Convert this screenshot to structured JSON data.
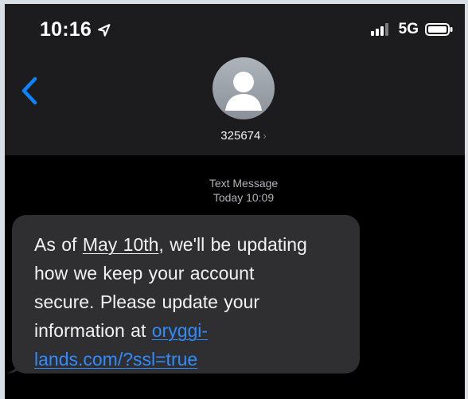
{
  "status_bar": {
    "time": "10:16",
    "network": "5G"
  },
  "header": {
    "back_icon": "chevron-left-icon",
    "avatar_icon": "person-icon",
    "contact_name": "325674",
    "contact_chevron": "›"
  },
  "conversation": {
    "message_type": "Text Message",
    "timestamp": "Today 10:09",
    "message": {
      "line1_prefix": "As of",
      "line1_highlight": "May 10th",
      "line1_suffix": ", we'll be updating",
      "line2": "how we keep your account",
      "line3": "secure. Please update your",
      "line4_prefix": "information at",
      "link_part1": "oryggi-",
      "link_part2": "lands.com/?ssl=true"
    }
  },
  "colors": {
    "header_bg": "#1c1c1e",
    "bubble_bg": "#2f2f31",
    "link": "#2f8cff",
    "accent": "#0a84ff"
  }
}
